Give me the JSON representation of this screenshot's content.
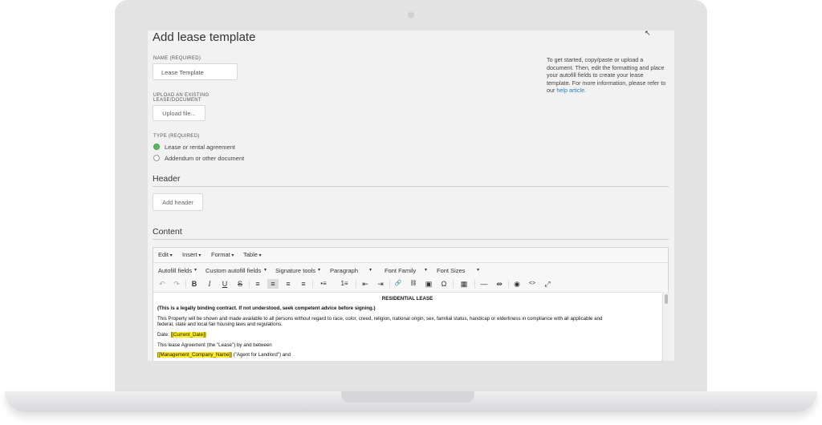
{
  "page": {
    "title": "Add lease template",
    "cursor_glyph": "↖"
  },
  "form": {
    "name_label": "NAME (REQUIRED)",
    "name_value": "Lease Template",
    "upload_label_line1": "UPLOAD AN EXISTING",
    "upload_label_line2": "LEASE/DOCUMENT",
    "upload_button": "Upload file...",
    "type_label": "TYPE (REQUIRED)",
    "type_options": [
      {
        "label": "Lease or rental agreement",
        "selected": true
      },
      {
        "label": "Addendum or other document",
        "selected": false
      }
    ]
  },
  "help": {
    "text": "To get started, copy/paste or upload a document. Then, edit the formatting and place your autofill fields to create your lease template. For more information, please refer to our",
    "link": "help article.",
    "link_color": "#2a7fc1"
  },
  "header_section": {
    "title": "Header",
    "button": "Add header"
  },
  "content_section": {
    "title": "Content"
  },
  "editor": {
    "menu": [
      "Edit",
      "Insert",
      "Format",
      "Table"
    ],
    "toolbar_dropdowns": [
      "Autofill fields",
      "Custom autofill fields",
      "Signature tools",
      "Paragraph",
      "Font Family",
      "Font Sizes"
    ],
    "toolbar_icons": {
      "undo": "↶",
      "redo": "↷",
      "bold": "B",
      "italic": "I",
      "underline": "U",
      "strike": "S",
      "align_left": "≡",
      "align_center": "≡",
      "align_right": "≡",
      "justify": "≡",
      "bullet_list": "•≡",
      "numbered_list": "1≡",
      "outdent": "⇤",
      "indent": "⇥",
      "link": "🔗",
      "unlink": "⛓",
      "image": "▣",
      "special_char": "Ω",
      "table": "▦",
      "hr": "—",
      "page_break": "⇹",
      "preview": "◉",
      "code": "<>",
      "fullscreen": "⤢"
    },
    "document": {
      "title": "RESIDENTIAL LEASE",
      "warning": "(This is a legally binding contract. If not understood, seek competent advice before signing.)",
      "equal_housing": "This Property will be shown and made available to all persons without regard to race, color, creed, religion, national origin, sex, familial status, handicap or elderliness in compliance with all applicable and",
      "equal_housing_2": "federal, state and local fair housing laws and regulations.",
      "date_label": "Date: ",
      "date_field": "[[Current_Date]]",
      "agreement": "This lease Agreement (the \"Lease\") by and between",
      "company_field": "[[Management_Company_Name]]",
      "agent_text": " (\"Agent for Landlord\") and"
    },
    "highlight_color": "#ffeb1c",
    "selected_radio_color": "#5cb85c"
  }
}
